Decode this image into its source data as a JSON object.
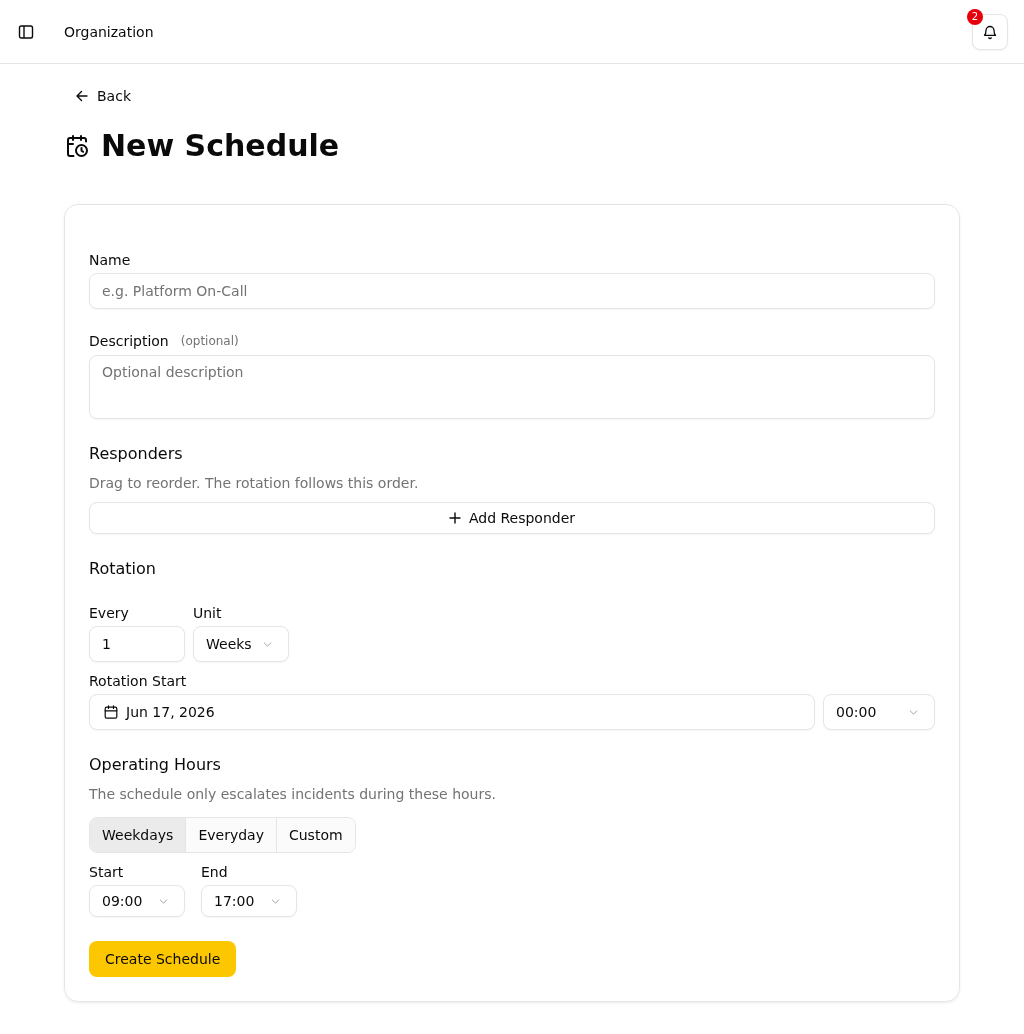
{
  "header": {
    "title": "Organization",
    "notifications": {
      "count": "2"
    }
  },
  "back_link": "Back",
  "page_title": "New Schedule",
  "form": {
    "name": {
      "label": "Name",
      "placeholder": "e.g. Platform On-Call"
    },
    "description": {
      "label": "Description",
      "hint": "(optional)",
      "placeholder": "Optional description"
    },
    "responders": {
      "heading": "Responders",
      "subtitle": "Drag to reorder. The rotation follows this order.",
      "add_button": "Add Responder"
    },
    "rotation": {
      "heading": "Rotation",
      "every": {
        "label": "Every",
        "value": "1"
      },
      "unit": {
        "label": "Unit",
        "value": "Weeks"
      },
      "start": {
        "label": "Rotation Start",
        "date": "Jun 17, 2026",
        "time": "00:00"
      }
    },
    "operating_hours": {
      "heading": "Operating Hours",
      "subtitle": "The schedule only escalates incidents during these hours.",
      "modes": [
        {
          "label": "Weekdays",
          "selected": true
        },
        {
          "label": "Everyday",
          "selected": false
        },
        {
          "label": "Custom",
          "selected": false
        }
      ],
      "start": {
        "label": "Start",
        "value": "09:00"
      },
      "end": {
        "label": "End",
        "value": "17:00"
      }
    },
    "submit": "Create Schedule"
  }
}
